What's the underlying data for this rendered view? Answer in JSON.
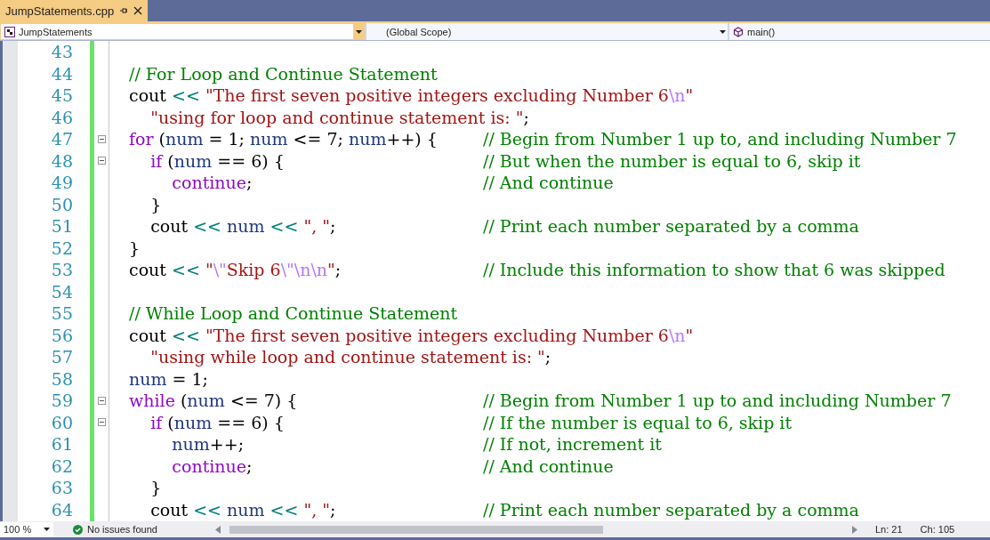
{
  "tab": {
    "title": "JumpStatements.cpp",
    "selected": true
  },
  "nav": [
    {
      "label": "JumpStatements"
    },
    {
      "label": "(Global Scope)"
    },
    {
      "label": "main()"
    }
  ],
  "lines": [
    {
      "number": "43",
      "fold": false
    },
    {
      "number": "44",
      "fold": false,
      "tokens": [
        {
          "t": "// For Loop and Continue Statement",
          "kind": "com"
        }
      ]
    },
    {
      "number": "45",
      "fold": false,
      "tokens": [
        {
          "t": "cout",
          "kind": "txt"
        },
        {
          "t": " << ",
          "kind": "op"
        },
        {
          "t": "\"The first seven positive integers excluding Number 6",
          "kind": "str"
        },
        {
          "t": "\\n",
          "kind": "esc"
        },
        {
          "t": "\"",
          "kind": "str"
        }
      ]
    },
    {
      "number": "46",
      "fold": false,
      "tokens": [
        {
          "t": "    \"using for loop and continue statement is: \"",
          "kind": "str"
        },
        {
          "t": ";",
          "kind": "txt"
        }
      ]
    },
    {
      "number": "47",
      "fold": true,
      "tokens": [
        {
          "t": "for",
          "kind": "kw"
        },
        {
          "t": " (",
          "kind": "txt"
        },
        {
          "t": "num",
          "kind": "var"
        },
        {
          "t": " = 1; ",
          "kind": "txt"
        },
        {
          "t": "num",
          "kind": "var"
        },
        {
          "t": " <= 7; ",
          "kind": "txt"
        },
        {
          "t": "num",
          "kind": "var"
        },
        {
          "t": "++) {",
          "kind": "txt"
        }
      ],
      "comment": "// Begin from Number 1 up to, and including Number 7"
    },
    {
      "number": "48",
      "fold": true,
      "tokens": [
        {
          "t": "    if",
          "kind": "kw"
        },
        {
          "t": " (",
          "kind": "txt"
        },
        {
          "t": "num",
          "kind": "var"
        },
        {
          "t": " == 6) {",
          "kind": "txt"
        }
      ],
      "comment": "// But when the number is equal to 6, skip it"
    },
    {
      "number": "49",
      "fold": false,
      "tokens": [
        {
          "t": "        continue",
          "kind": "kw"
        },
        {
          "t": ";",
          "kind": "txt"
        }
      ],
      "comment": "// And continue"
    },
    {
      "number": "50",
      "fold": false,
      "tokens": [
        {
          "t": "    }",
          "kind": "txt"
        }
      ]
    },
    {
      "number": "51",
      "fold": false,
      "tokens": [
        {
          "t": "    cout",
          "kind": "txt"
        },
        {
          "t": " << ",
          "kind": "op"
        },
        {
          "t": "num",
          "kind": "var"
        },
        {
          "t": " << ",
          "kind": "op"
        },
        {
          "t": "\", \"",
          "kind": "str"
        },
        {
          "t": ";",
          "kind": "txt"
        }
      ],
      "comment": "// Print each number separated by a comma"
    },
    {
      "number": "52",
      "fold": false,
      "tokens": [
        {
          "t": "}",
          "kind": "txt"
        }
      ]
    },
    {
      "number": "53",
      "fold": false,
      "tokens": [
        {
          "t": "cout",
          "kind": "txt"
        },
        {
          "t": " << ",
          "kind": "op"
        },
        {
          "t": "\"",
          "kind": "str"
        },
        {
          "t": "\\\"",
          "kind": "esc"
        },
        {
          "t": "Skip 6",
          "kind": "str"
        },
        {
          "t": "\\\"\\n\\n",
          "kind": "esc"
        },
        {
          "t": "\"",
          "kind": "str"
        },
        {
          "t": ";",
          "kind": "txt"
        }
      ],
      "comment": "// Include this information to show that 6 was skipped"
    },
    {
      "number": "54",
      "fold": false
    },
    {
      "number": "55",
      "fold": false,
      "tokens": [
        {
          "t": "// While Loop and Continue Statement",
          "kind": "com"
        }
      ]
    },
    {
      "number": "56",
      "fold": false,
      "tokens": [
        {
          "t": "cout",
          "kind": "txt"
        },
        {
          "t": " << ",
          "kind": "op"
        },
        {
          "t": "\"The first seven positive integers excluding Number 6",
          "kind": "str"
        },
        {
          "t": "\\n",
          "kind": "esc"
        },
        {
          "t": "\"",
          "kind": "str"
        }
      ]
    },
    {
      "number": "57",
      "fold": false,
      "tokens": [
        {
          "t": "    \"using while loop and continue statement is: \"",
          "kind": "str"
        },
        {
          "t": ";",
          "kind": "txt"
        }
      ]
    },
    {
      "number": "58",
      "fold": false,
      "tokens": [
        {
          "t": "num",
          "kind": "var"
        },
        {
          "t": " = 1;",
          "kind": "txt"
        }
      ]
    },
    {
      "number": "59",
      "fold": true,
      "tokens": [
        {
          "t": "while",
          "kind": "kw"
        },
        {
          "t": " (",
          "kind": "txt"
        },
        {
          "t": "num",
          "kind": "var"
        },
        {
          "t": " <= 7) {",
          "kind": "txt"
        }
      ],
      "comment": "// Begin from Number 1 up to and including Number 7"
    },
    {
      "number": "60",
      "fold": true,
      "tokens": [
        {
          "t": "    if",
          "kind": "kw"
        },
        {
          "t": " (",
          "kind": "txt"
        },
        {
          "t": "num",
          "kind": "var"
        },
        {
          "t": " == 6) {",
          "kind": "txt"
        }
      ],
      "comment": "// If the number is equal to 6, skip it"
    },
    {
      "number": "61",
      "fold": false,
      "tokens": [
        {
          "t": "        num",
          "kind": "var"
        },
        {
          "t": "++;",
          "kind": "txt"
        }
      ],
      "comment": "// If not, increment it"
    },
    {
      "number": "62",
      "fold": false,
      "tokens": [
        {
          "t": "        continue",
          "kind": "kw"
        },
        {
          "t": ";",
          "kind": "txt"
        }
      ],
      "comment": "// And continue"
    },
    {
      "number": "63",
      "fold": false,
      "tokens": [
        {
          "t": "    }",
          "kind": "txt"
        }
      ]
    },
    {
      "number": "64",
      "fold": false,
      "tokens": [
        {
          "t": "    cout",
          "kind": "txt"
        },
        {
          "t": " << ",
          "kind": "op"
        },
        {
          "t": "num",
          "kind": "var"
        },
        {
          "t": " << ",
          "kind": "op"
        },
        {
          "t": "\", \"",
          "kind": "str"
        },
        {
          "t": ";",
          "kind": "txt"
        }
      ],
      "comment": "// Print each number separated by a comma"
    }
  ],
  "status": {
    "zoom": "100 %",
    "issues": "No issues found",
    "line": "Ln: 21",
    "column": "Ch: 105"
  }
}
